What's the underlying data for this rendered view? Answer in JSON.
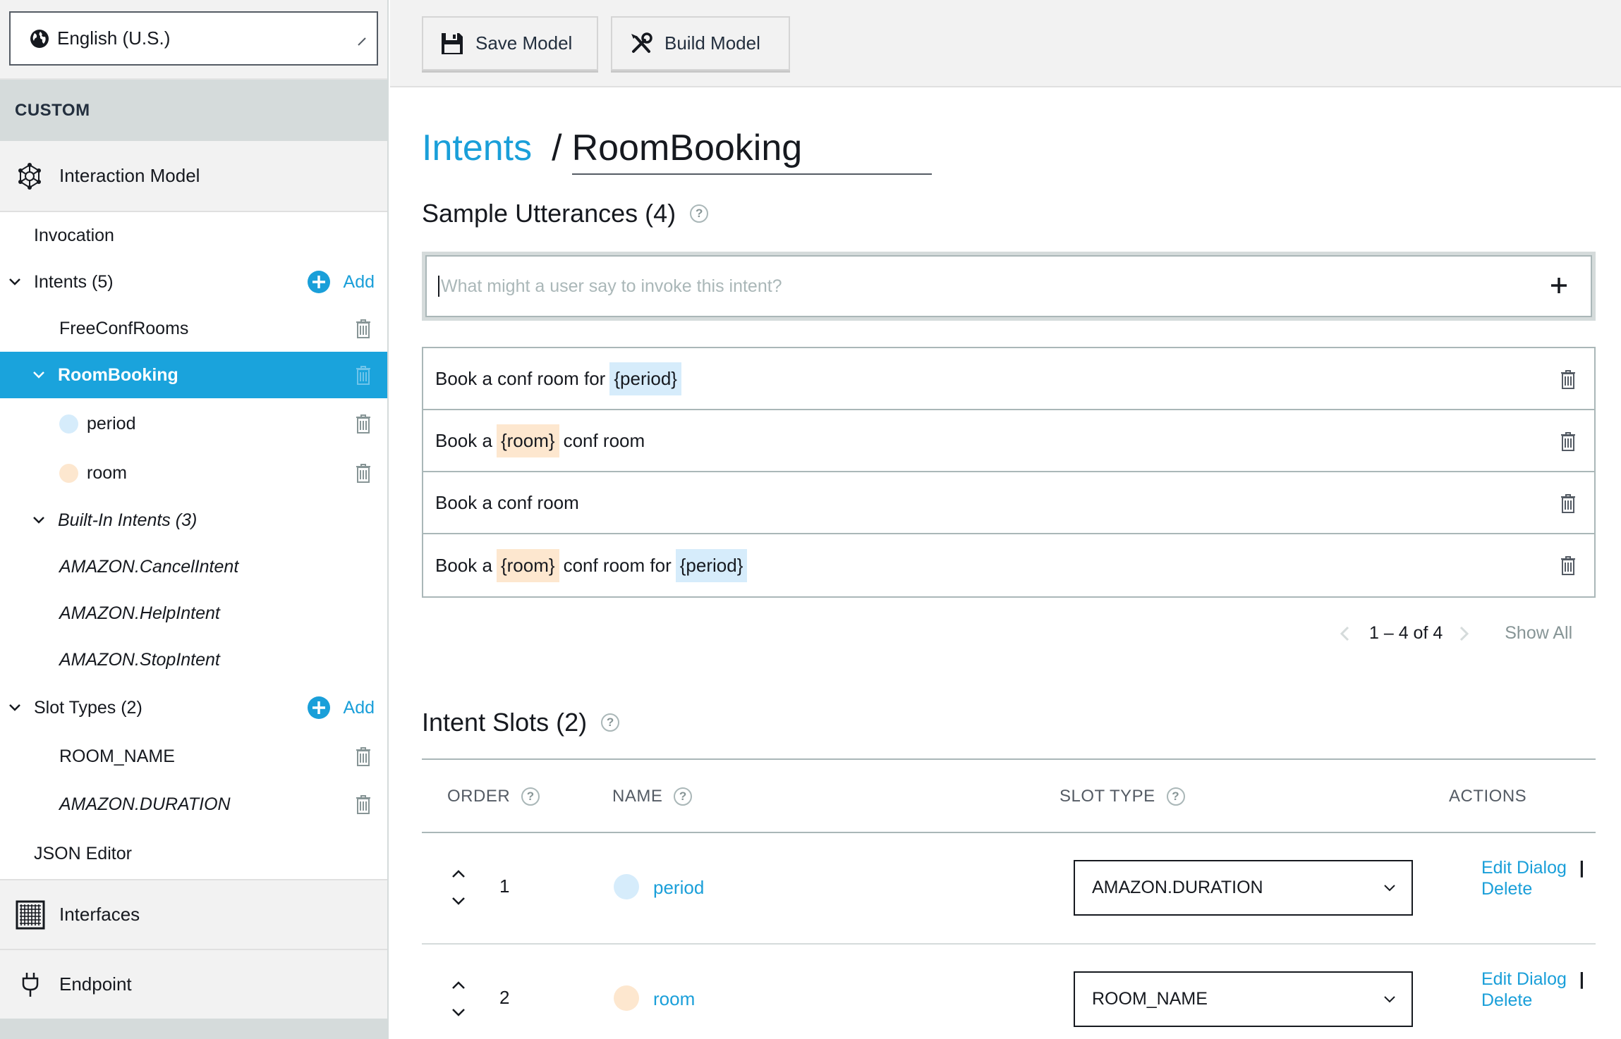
{
  "sidebar": {
    "language": "English (U.S.)",
    "custom_label": "CUSTOM",
    "interaction_model": "Interaction Model",
    "invocation": "Invocation",
    "intents_label": "Intents (5)",
    "add_label": "Add",
    "intents": [
      "FreeConfRooms",
      "RoomBooking"
    ],
    "slots": [
      "period",
      "room"
    ],
    "builtin_label": "Built-In Intents (3)",
    "builtin_intents": [
      "AMAZON.CancelIntent",
      "AMAZON.HelpIntent",
      "AMAZON.StopIntent"
    ],
    "slot_types_label": "Slot Types (2)",
    "slot_types": [
      "ROOM_NAME",
      "AMAZON.DURATION"
    ],
    "json_editor": "JSON Editor",
    "interfaces": "Interfaces",
    "endpoint": "Endpoint"
  },
  "toolbar": {
    "save_label": "Save Model",
    "build_label": "Build Model"
  },
  "breadcrumb": {
    "parent": "Intents",
    "separator": "/",
    "current": "RoomBooking"
  },
  "utterances": {
    "title": "Sample Utterances (4)",
    "placeholder": "What might a user say to invoke this intent?",
    "rows": [
      {
        "p1": "Book a conf room for",
        "s1": "{period}"
      },
      {
        "p1": "Book a",
        "s1": "{room}",
        "p2": "conf room"
      },
      {
        "p1": "Book a conf room"
      },
      {
        "p1": "Book a",
        "s1": "{room}",
        "p2": "conf room for",
        "s2": "{period}"
      }
    ],
    "pager": "1 – 4 of 4",
    "show_all": "Show All"
  },
  "slots": {
    "title": "Intent Slots (2)",
    "headers": {
      "order": "ORDER",
      "name": "NAME",
      "slot_type": "SLOT TYPE",
      "actions": "ACTIONS"
    },
    "rows": [
      {
        "order": "1",
        "name": "period",
        "type": "AMAZON.DURATION"
      },
      {
        "order": "2",
        "name": "room",
        "type": "ROOM_NAME"
      }
    ],
    "edit_label": "Edit Dialog",
    "pipe": "|",
    "delete_label": "Delete"
  },
  "help_glyph": "?",
  "colors": {
    "accent": "#1aa3dc",
    "link": "#1a9fd9",
    "period_slot": "#d6ecfb",
    "room_slot": "#fde7cf"
  }
}
